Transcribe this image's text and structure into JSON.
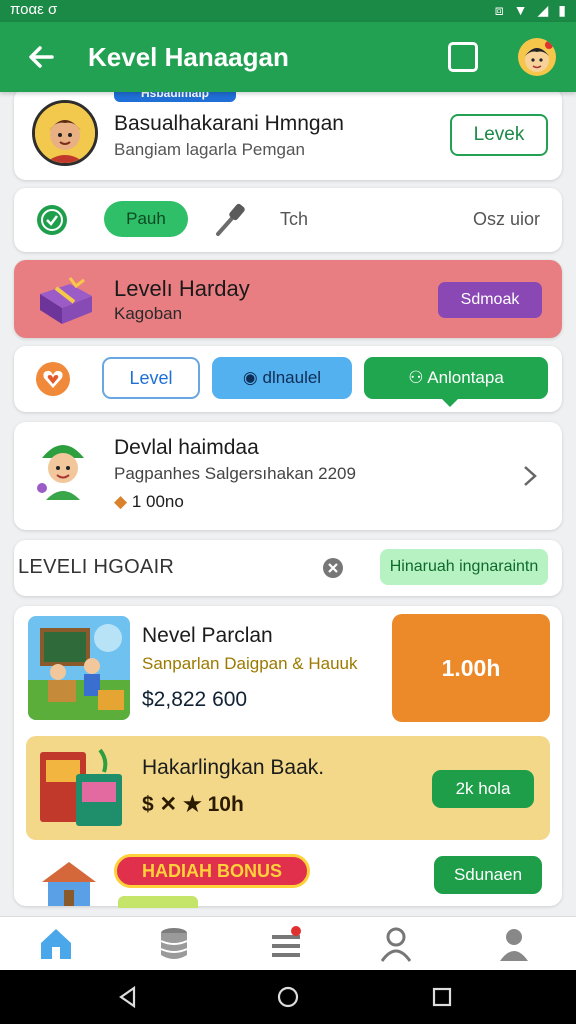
{
  "status_bar": {
    "time": "ποαε σ"
  },
  "app_bar": {
    "title": "Kevel Hanaagan"
  },
  "profile": {
    "tag": "Hsbadlmalp",
    "name": "Basualhakarani Hmngan",
    "subtitle": "Bangiam lagarla Pemgan",
    "button": "Levek"
  },
  "filter_row": {
    "pill": "Pauh",
    "label": "Tch",
    "right_text": "Osz uior"
  },
  "promo": {
    "title": "Levelı Harday",
    "subtitle": "Kagoban",
    "button": "Sdmoak"
  },
  "tabs": [
    {
      "label": "Level"
    },
    {
      "label": "dlnaulel",
      "icon": "camera-icon"
    },
    {
      "label": "Anlontapa",
      "icon": "people-icon"
    }
  ],
  "level_item": {
    "title": "Devlal haimdaa",
    "subtitle": "Pagpanhes Salgersıhakan 2209",
    "coins": "1 00no"
  },
  "section": {
    "title": "LEVELI HGOAIR",
    "pill": "Hinaruah ingnaraintn"
  },
  "product": {
    "title": "Nevel Parclan",
    "subtitle": "Sanparlan Daigpan & Hauuk",
    "price": "$2,822 600",
    "box_value": "1.00h"
  },
  "reward": {
    "title": "Hakarlingkan Baak.",
    "stats": "$ ✕ ★ 10h",
    "button": "2k hola"
  },
  "bonus": {
    "pill": "HADIAH BONUS",
    "button": "Sdunaen"
  },
  "colors": {
    "primary": "#22a152",
    "accent_orange": "#ec8a2a",
    "promo_red": "#e97e82",
    "purple": "#8a48b4",
    "yellow": "#f3d88a"
  },
  "bottom_nav": [
    {
      "icon": "home-icon",
      "active": true
    },
    {
      "icon": "database-icon"
    },
    {
      "icon": "list-icon"
    },
    {
      "icon": "people-icon"
    },
    {
      "icon": "person-icon"
    }
  ]
}
